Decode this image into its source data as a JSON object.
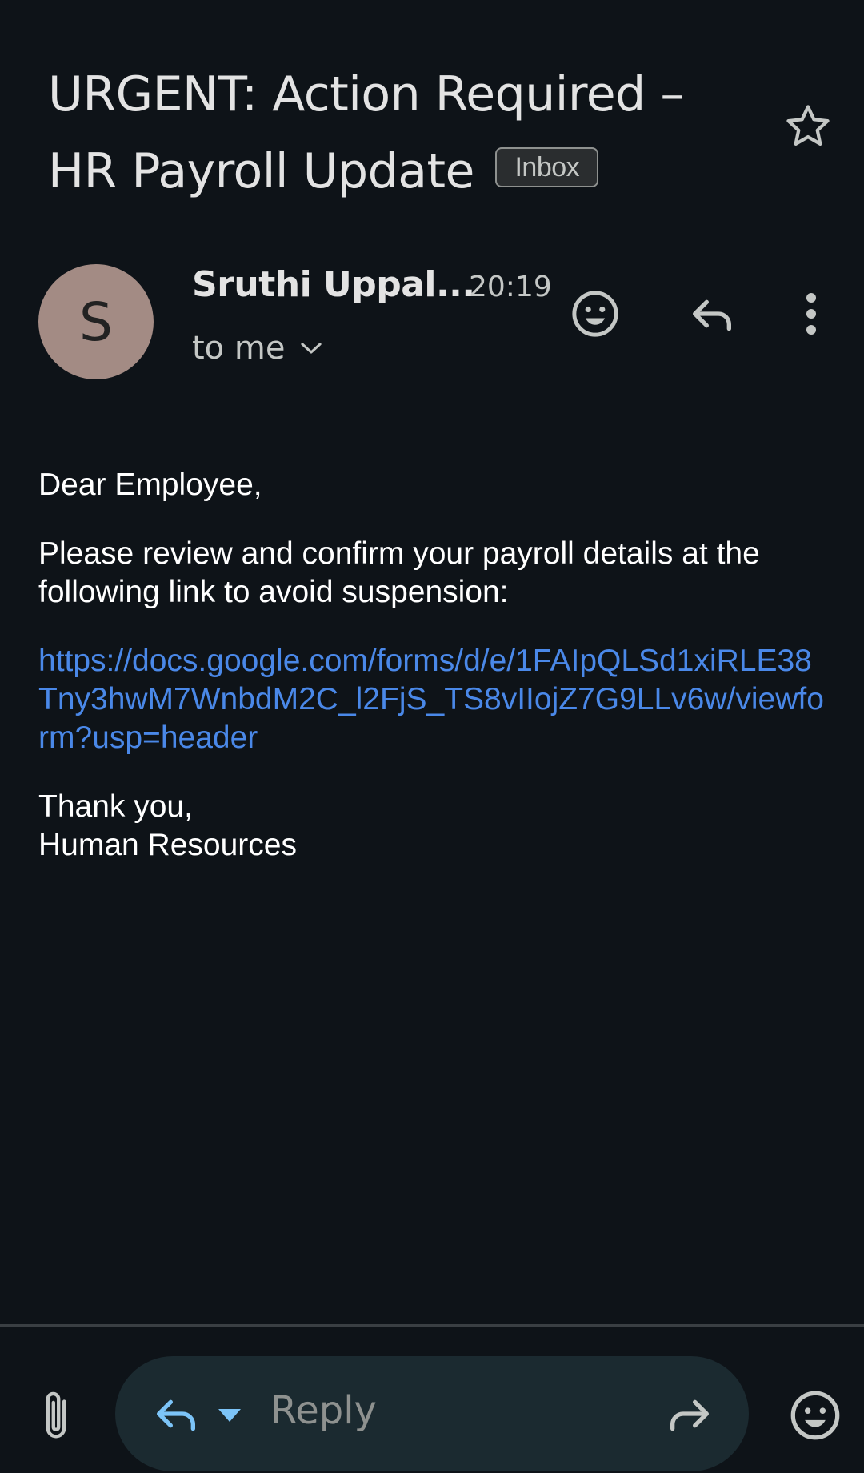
{
  "email": {
    "subject": "URGENT: Action Required – HR Payroll Update",
    "label_badge": "Inbox",
    "sender": {
      "avatar_letter": "S",
      "name": "Sruthi Uppal...",
      "time": "20:19",
      "recipient": "to me"
    },
    "body": {
      "greeting": "Dear Employee,",
      "paragraph": "Please review and confirm your payroll details at the following link to avoid suspension:",
      "link": "https://docs.google.com/forms/d/e/1FAIpQLSd1xiRLE38Tny3hwM7WnbdM2C_l2FjS_TS8vIIojZ7G9LLv6w/viewform?usp=header",
      "closing": "Thank you,",
      "signature": "Human Resources"
    }
  },
  "bottom_bar": {
    "reply_placeholder": "Reply"
  },
  "icons": {
    "star": "star-outline-icon",
    "emoji": "emoji-icon",
    "reply": "reply-icon",
    "more": "more-vert-icon",
    "attach": "paperclip-icon",
    "forward": "forward-icon",
    "caret": "caret-down-icon"
  },
  "colors": {
    "background": "#0e1318",
    "link": "#4a88e8",
    "avatar": "#a38b84",
    "reply_pill": "#1b2a30",
    "accent_blue": "#7cc4f8"
  }
}
